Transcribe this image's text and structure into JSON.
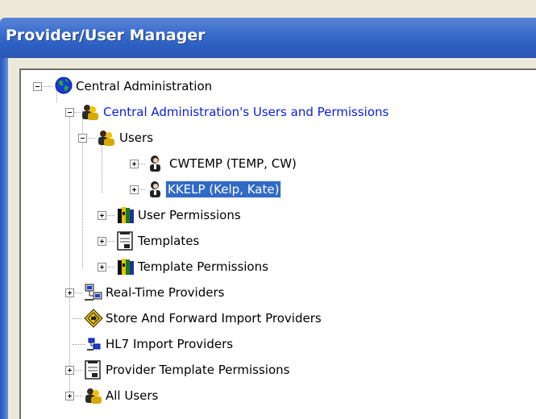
{
  "window": {
    "title": "Provider/User Manager"
  },
  "tree": {
    "root": {
      "label": "Central Administration",
      "icon": "globe-icon"
    },
    "users_permissions": {
      "label": "Central Administration's Users and Permissions",
      "icon": "users-group-icon"
    },
    "users": {
      "label": "Users",
      "icon": "users-group-icon"
    },
    "user_cwtemp": {
      "label": "CWTEMP (TEMP, CW)",
      "icon": "user-icon"
    },
    "user_kkelp": {
      "label": "KKELP (Kelp, Kate)",
      "icon": "user-icon",
      "selected": true
    },
    "user_permissions": {
      "label": "User Permissions",
      "icon": "books-icon"
    },
    "templates": {
      "label": "Templates",
      "icon": "document-icon"
    },
    "template_permissions": {
      "label": "Template Permissions",
      "icon": "books-icon"
    },
    "realtime_providers": {
      "label": "Real-Time Providers",
      "icon": "network-icon"
    },
    "store_forward": {
      "label": "Store And Forward Import Providers",
      "icon": "diamond-sign-icon"
    },
    "hl7_import": {
      "label": "HL7 Import Providers",
      "icon": "hl7-icon"
    },
    "provider_template_permissions": {
      "label": "Provider Template Permissions",
      "icon": "document-icon"
    },
    "all_users": {
      "label": "All Users",
      "icon": "users-group-icon"
    }
  },
  "colors": {
    "title_bar": "#2d5fc2",
    "selection": "#316ac5",
    "link_blue": "#0b1ee0"
  }
}
